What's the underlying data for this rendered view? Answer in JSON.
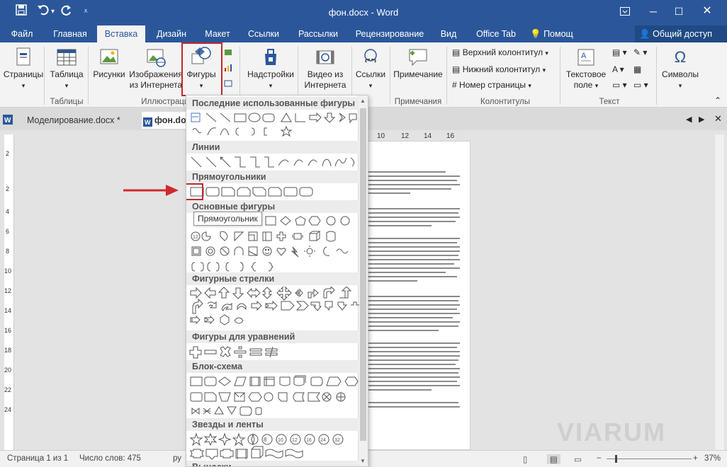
{
  "window": {
    "title": "фон.docx - Word",
    "controls": [
      "box-icon",
      "minimize",
      "maximize",
      "close"
    ]
  },
  "tabs": [
    "Файл",
    "Главная",
    "Вставка",
    "Дизайн",
    "Макет",
    "Ссылки",
    "Рассылки",
    "Рецензирование",
    "Вид",
    "Office Tab"
  ],
  "active_tab": "Вставка",
  "tell_me": "Помощ",
  "share": "Общий доступ",
  "ribbon": {
    "pages": "Страницы",
    "table": "Таблица",
    "pictures": "Рисунки",
    "online_pictures_1": "Изображения",
    "online_pictures_2": "из Интернета",
    "shapes": "Фигуры",
    "addins": "Надстройки",
    "video_1": "Видео из",
    "video_2": "Интернета",
    "links": "Ссылки",
    "comment": "Примечание",
    "header": "Верхний колонтитул",
    "footer": "Нижний колонтитул",
    "page_number": "Номер страницы",
    "textbox_1": "Текстовое",
    "textbox_2": "поле",
    "symbols": "Символы",
    "groups": {
      "tables": "Таблицы",
      "illustrations": "Иллюстрации",
      "comments": "Примечания",
      "header_footer": "Колонтитулы",
      "text": "Текст"
    }
  },
  "doc_tabs": [
    {
      "label": "Моделирование.docx *",
      "active": false
    },
    {
      "label": "фон.docx",
      "active": true
    }
  ],
  "ruler_top": [
    "10",
    "12",
    "14",
    "16"
  ],
  "ruler_left": [
    "2",
    "2",
    "4",
    "6",
    "8",
    "10",
    "12",
    "14",
    "16",
    "18",
    "20",
    "22",
    "24"
  ],
  "shapes_menu": {
    "sections": [
      "Последние использованные фигуры",
      "Линии",
      "Прямоугольники",
      "Основные фигуры",
      "Фигурные стрелки",
      "Фигуры для уравнений",
      "Блок-схема",
      "Звезды и ленты",
      "Выноски"
    ],
    "tooltip": "Прямоугольник"
  },
  "statusbar": {
    "page": "Страница 1 из 1",
    "words": "Число слов: 475",
    "lang": "ру",
    "zoom": "37%"
  },
  "watermark": "VIARUM",
  "colors": {
    "word_blue": "#2b579a",
    "highlight_red": "#c0282e"
  }
}
